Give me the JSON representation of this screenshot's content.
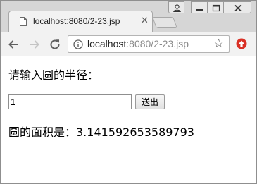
{
  "browser": {
    "tab_title": "localhost:8080/2-23.jsp",
    "url_host": "localhost",
    "url_rest": ":8080/2-23.jsp",
    "icons": {
      "page": "page-icon",
      "close_tab": "close-icon",
      "back": "back-arrow-icon",
      "forward": "forward-arrow-icon",
      "reload": "reload-icon",
      "info": "info-icon",
      "bookmark": "star-icon",
      "extension": "extension-icon"
    },
    "colors": {
      "extension_red": "#d93025"
    }
  },
  "page": {
    "prompt": "请输入圆的半径：",
    "radius_value": "1",
    "submit_label": "送出",
    "result": "圆的面积是：3.141592653589793"
  }
}
